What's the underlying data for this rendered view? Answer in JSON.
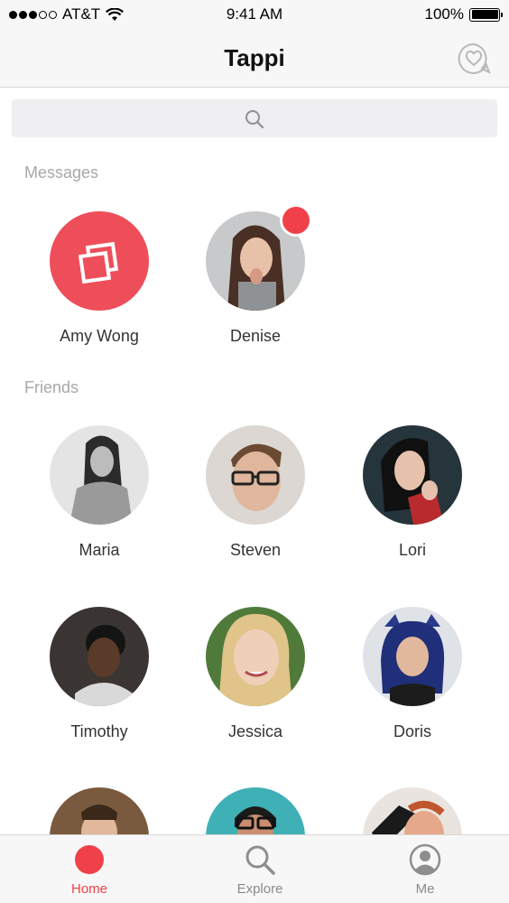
{
  "status_bar": {
    "carrier": "AT&T",
    "time": "9:41 AM",
    "battery": "100%",
    "battery_level": 1.0
  },
  "nav": {
    "title": "Tappi",
    "right_icon": "heart-chat-icon"
  },
  "search": {
    "icon": "search-icon"
  },
  "messages": {
    "title": "Messages",
    "items": [
      {
        "name": "Amy Wong",
        "kind": "group-photo",
        "color": "#ee4e5a",
        "unread": false
      },
      {
        "name": "Denise",
        "kind": "photo",
        "unread": true
      }
    ]
  },
  "friends": {
    "title": "Friends",
    "items": [
      {
        "name": "Maria"
      },
      {
        "name": "Steven"
      },
      {
        "name": "Lori"
      },
      {
        "name": "Timothy"
      },
      {
        "name": "Jessica"
      },
      {
        "name": "Doris"
      },
      {
        "name": ""
      },
      {
        "name": ""
      },
      {
        "name": ""
      }
    ]
  },
  "tabs": [
    {
      "label": "Home",
      "icon": "home-dot-icon",
      "active": true
    },
    {
      "label": "Explore",
      "icon": "search-icon",
      "active": false
    },
    {
      "label": "Me",
      "icon": "user-icon",
      "active": false
    }
  ],
  "colors": {
    "accent": "#f0414a",
    "section_text": "#a8a8a8"
  }
}
